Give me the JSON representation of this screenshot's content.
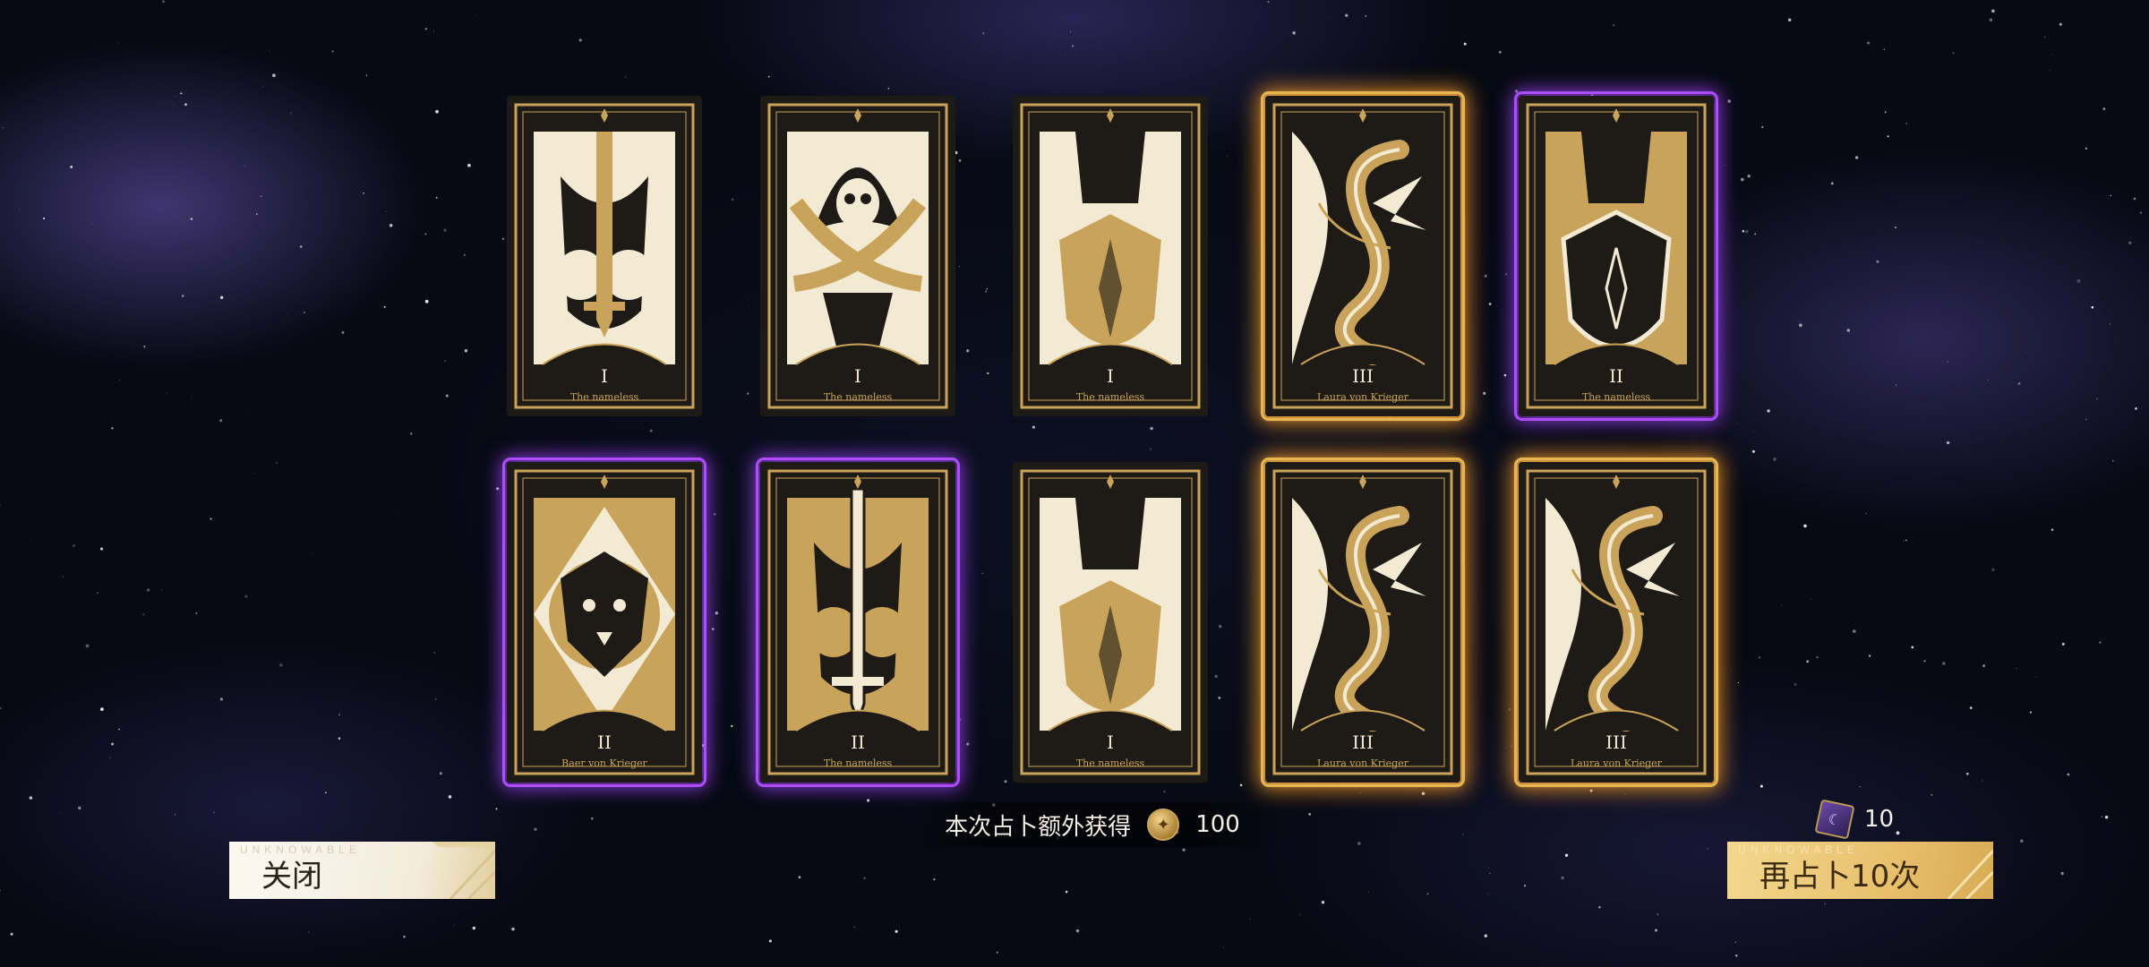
{
  "cards": [
    {
      "numeral": "I",
      "caption": "The nameless",
      "art": "sword-helm",
      "rarity": "normal"
    },
    {
      "numeral": "I",
      "caption": "The nameless",
      "art": "hooded-dual-blades",
      "rarity": "normal"
    },
    {
      "numeral": "I",
      "caption": "The nameless",
      "art": "knight-shield",
      "rarity": "normal"
    },
    {
      "numeral": "III",
      "caption": "Laura von Krieger",
      "art": "dragon",
      "rarity": "legend"
    },
    {
      "numeral": "II",
      "caption": "The nameless",
      "art": "knight-shield-dark",
      "rarity": "epic"
    },
    {
      "numeral": "II",
      "caption": "Baer von Krieger",
      "art": "lion",
      "rarity": "epic"
    },
    {
      "numeral": "II",
      "caption": "The nameless",
      "art": "sword-helm-dark",
      "rarity": "epic"
    },
    {
      "numeral": "I",
      "caption": "The nameless",
      "art": "knight-shield",
      "rarity": "normal"
    },
    {
      "numeral": "III",
      "caption": "Laura von Krieger",
      "art": "dragon",
      "rarity": "legend"
    },
    {
      "numeral": "III",
      "caption": "Laura von Krieger",
      "art": "dragon",
      "rarity": "legend"
    }
  ],
  "reward": {
    "label": "本次占卜额外获得",
    "amount": "100",
    "icon": "coin-icon"
  },
  "ticket": {
    "count": "10",
    "icon": "divination-ticket-icon"
  },
  "buttons": {
    "close": {
      "tag": "UNKNOWABLE",
      "label": "关闭"
    },
    "again": {
      "tag": "UNKNOWABLE",
      "label": "再占卜10次"
    }
  },
  "colors": {
    "gold": "#c9a35a",
    "cream": "#f2ead2",
    "dark": "#1e1b16",
    "epic": "#b04cff",
    "legend": "#f0a030"
  }
}
